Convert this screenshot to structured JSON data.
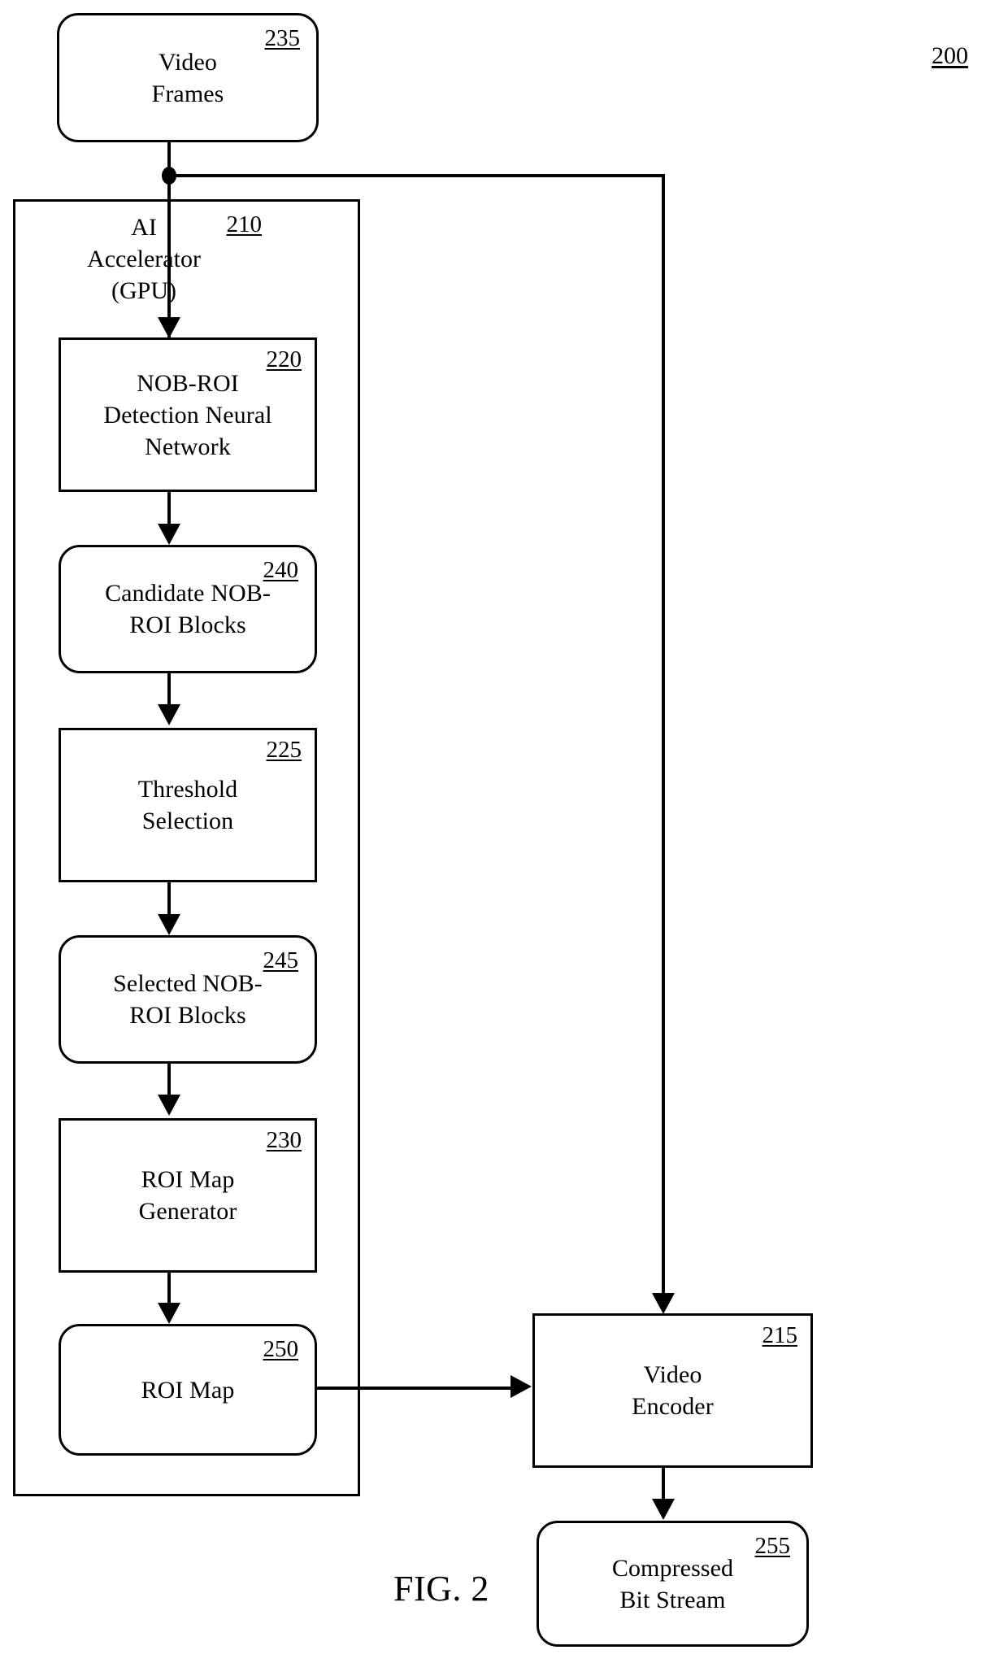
{
  "figure": {
    "caption": "FIG. 2",
    "system_ref": "200"
  },
  "nodes": {
    "video_frames": {
      "ref": "235",
      "label": "Video\nFrames"
    },
    "ai_accelerator": {
      "ref": "210",
      "label": "AI\nAccelerator\n(GPU)"
    },
    "nob_roi_nn": {
      "ref": "220",
      "label": "NOB-ROI\nDetection Neural\nNetwork"
    },
    "candidate_blocks": {
      "ref": "240",
      "label": "Candidate NOB-\nROI Blocks"
    },
    "threshold_selection": {
      "ref": "225",
      "label": "Threshold\nSelection"
    },
    "selected_blocks": {
      "ref": "245",
      "label": "Selected NOB-\nROI Blocks"
    },
    "roi_map_generator": {
      "ref": "230",
      "label": "ROI Map\nGenerator"
    },
    "roi_map": {
      "ref": "250",
      "label": "ROI Map"
    },
    "video_encoder": {
      "ref": "215",
      "label": "Video\nEncoder"
    },
    "compressed_bitstream": {
      "ref": "255",
      "label": "Compressed\nBit Stream"
    }
  },
  "colors": {
    "stroke": "#000000",
    "background": "#ffffff"
  }
}
